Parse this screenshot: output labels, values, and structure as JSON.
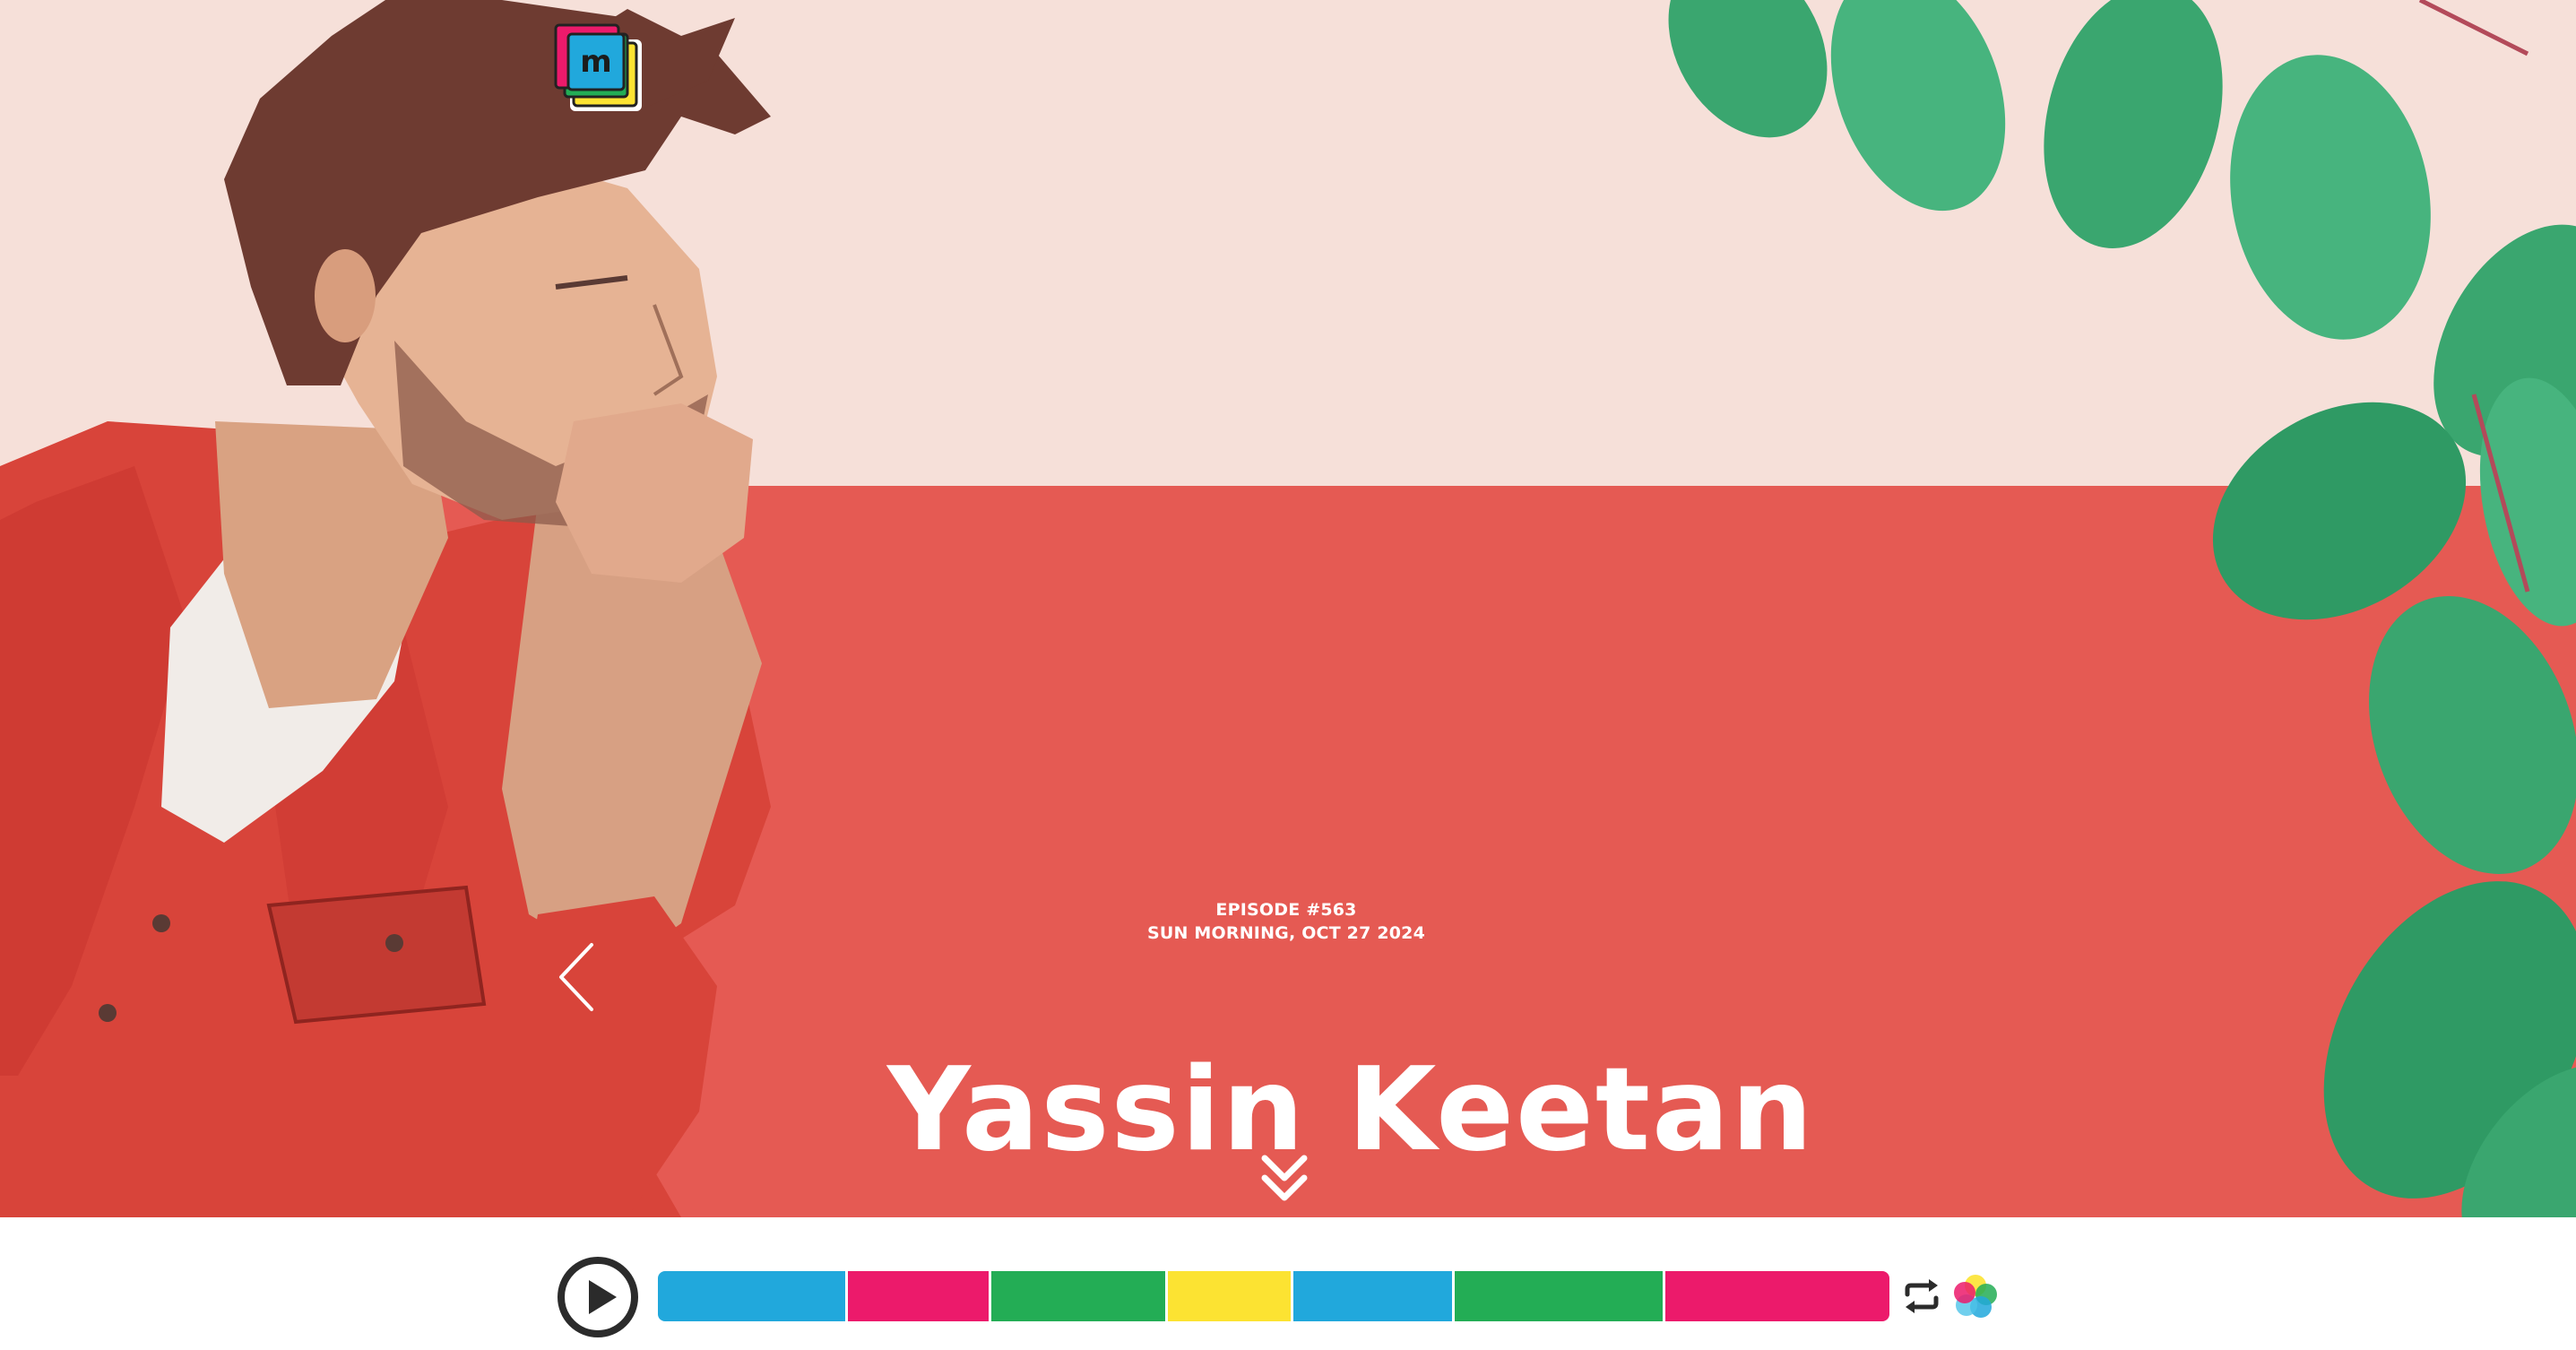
{
  "hero": {
    "episode_label": "EPISODE #563",
    "broadcast_label": "SUN MORNING, OCT 27 2024",
    "artist_name": "Yassin Keetan",
    "colors": {
      "top_band": "#f6e0d9",
      "bottom_band": "#e55a53",
      "text": "#ffffff"
    }
  },
  "logo": {
    "icon": "m-logo-icon",
    "letter": "m"
  },
  "navigation": {
    "prev_icon": "chevron-left-icon",
    "scroll_icon": "double-chevron-down-icon"
  },
  "player": {
    "play_icon": "play-icon",
    "repeat_icon": "repeat-icon",
    "platform_icon": "mixcloud-petal-icon",
    "timeline_segments": [
      {
        "color": "#21a8dc",
        "share": 0.154
      },
      {
        "color": "#ec1a6b",
        "share": 0.117
      },
      {
        "color": "#23ad55",
        "share": 0.143
      },
      {
        "color": "#fce332",
        "share": 0.102
      },
      {
        "color": "#21a8dc",
        "share": 0.131
      },
      {
        "color": "#23ad55",
        "share": 0.171
      },
      {
        "color": "#ec1a6b",
        "share": 0.182
      }
    ]
  }
}
